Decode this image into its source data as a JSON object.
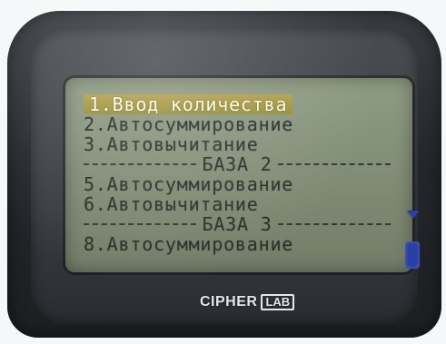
{
  "device": {
    "brand_logo_text": "CIPHER LAB",
    "brand_main": "CIPHER",
    "brand_box": "LAB"
  },
  "screen": {
    "menu": [
      {
        "text": "1.Ввод количества",
        "selected": true
      },
      {
        "text": "2.Автосуммирование"
      },
      {
        "text": "3.Автовычитание"
      },
      {
        "text": "БАЗА 2",
        "is_separator": true
      },
      {
        "text": "5.Автосуммирование"
      },
      {
        "text": "6.Автовычитание"
      },
      {
        "text": "БАЗА 3",
        "is_separator": true
      },
      {
        "text": "8.Автосуммирование"
      }
    ],
    "scroll_icons": [
      "scroll-down-arrow-icon",
      "scrollbar-thumb-icon"
    ]
  },
  "colors": {
    "selection": "#9a8d3a",
    "lcd_background": "#8f9c83",
    "scroll_accent": "#2b3ea6"
  }
}
